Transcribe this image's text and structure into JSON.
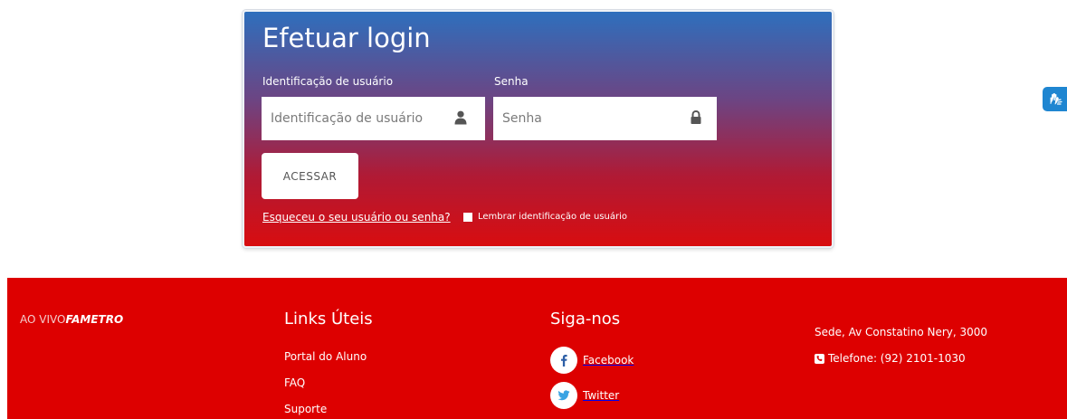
{
  "login": {
    "title": "Efetuar login",
    "username_label": "Identificação de usuário",
    "username_placeholder": "Identificação de usuário",
    "password_label": "Senha",
    "password_placeholder": "Senha",
    "submit_label": "ACESSAR",
    "forgot_link": "Esqueceu o seu usuário ou senha?",
    "remember_label": "Lembrar identificação de usuário",
    "user_icon": "user-icon",
    "password_icon": "lock-icon"
  },
  "accessibility": {
    "icon": "sign-language-icon",
    "color": "#1f86d1"
  },
  "footer": {
    "brand_light": "AO VIVO",
    "brand_bold": "FAMETRO",
    "links_title": "Links Úteis",
    "links": [
      "Portal do Aluno",
      "FAQ",
      "Suporte"
    ],
    "social_title": "Siga-nos",
    "social": [
      {
        "label": "Facebook",
        "icon": "facebook-icon"
      },
      {
        "label": "Twitter",
        "icon": "twitter-icon"
      }
    ],
    "address": "Sede, Av Constatino Nery, 3000",
    "phone": "Telefone: (92) 2101-1030",
    "phone_icon": "phone-icon",
    "background": "#dd0000"
  }
}
